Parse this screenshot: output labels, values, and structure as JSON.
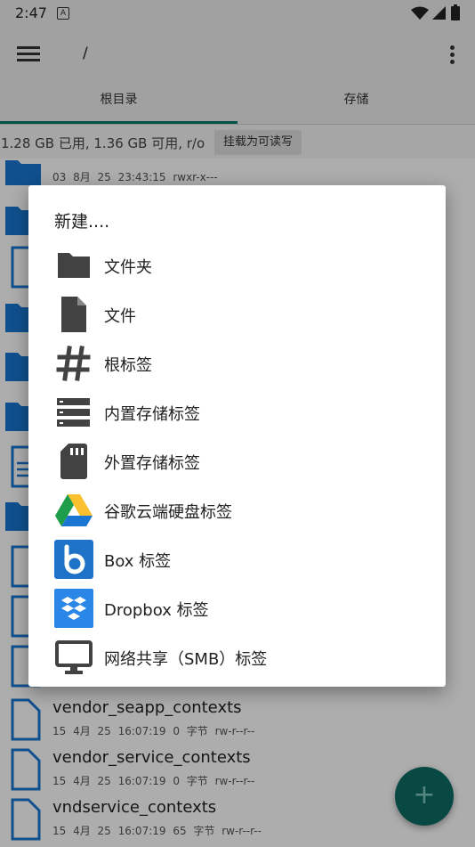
{
  "status_bar": {
    "time": "2:47",
    "notification_letter": "A"
  },
  "app_bar": {
    "path": "/"
  },
  "tabs": [
    {
      "label": "根目录"
    },
    {
      "label": "存储"
    }
  ],
  "storage_info": {
    "text": "1.28 GB 已用, 1.36 GB 可用, r/o",
    "button_label": "挂载为可读写"
  },
  "files": [
    {
      "name": "",
      "meta": "03 8月 25 23:43:15   rwxr-x---",
      "icon": "folder-icon"
    },
    {
      "name": "vendor_seapp_contexts",
      "meta": "15 4月 25 16:07:19  0 字节  rw-r--r--",
      "icon": "file-icon"
    },
    {
      "name": "vendor_service_contexts",
      "meta": "15 4月 25 16:07:19  0 字节  rw-r--r--",
      "icon": "file-icon"
    },
    {
      "name": "vndservice_contexts",
      "meta": "15 4月 25 16:07:19  65 字节  rw-r--r--",
      "icon": "file-icon"
    }
  ],
  "dialog": {
    "title": "新建....",
    "items": [
      {
        "label": "文件夹",
        "icon": "folder-icon"
      },
      {
        "label": "文件",
        "icon": "file-icon"
      },
      {
        "label": "根标签",
        "icon": "hash-icon"
      },
      {
        "label": "内置存储标签",
        "icon": "storage-icon"
      },
      {
        "label": "外置存储标签",
        "icon": "sd-card-icon"
      },
      {
        "label": "谷歌云端硬盘标签",
        "icon": "google-drive-icon"
      },
      {
        "label": "Box 标签",
        "icon": "box-icon"
      },
      {
        "label": "Dropbox 标签",
        "icon": "dropbox-icon"
      },
      {
        "label": "网络共享（SMB）标签",
        "icon": "monitor-icon"
      }
    ]
  },
  "fab": {
    "label": "+"
  },
  "colors": {
    "accent": "#00796b",
    "folder": "#1976d2",
    "fab": "#0d6e64"
  }
}
